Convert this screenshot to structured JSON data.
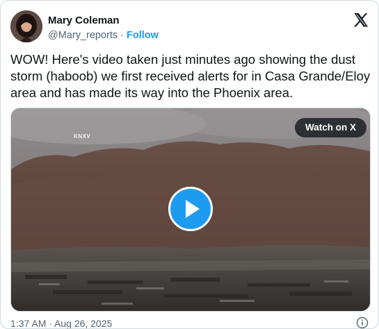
{
  "author": {
    "name": "Mary Coleman",
    "handle": "@Mary_reports",
    "separator": "·",
    "follow_label": "Follow"
  },
  "tweet": {
    "text": "WOW! Here's video taken just minutes ago showing the dust storm (haboob) we first received alerts for in Casa Grande/Eloy area and has made its way into the Phoenix area."
  },
  "media": {
    "station_logo": "KNXV",
    "watch_label": "Watch on X",
    "play_icon": "play-icon"
  },
  "footer": {
    "timestamp": "1:37 AM · Aug 26, 2025",
    "info_icon": "info-icon"
  },
  "icons": {
    "brand": "x-logo-icon"
  },
  "colors": {
    "accent": "#1d9bf0",
    "text": "#0f1419",
    "muted": "#536471",
    "border": "#cfd9de"
  }
}
